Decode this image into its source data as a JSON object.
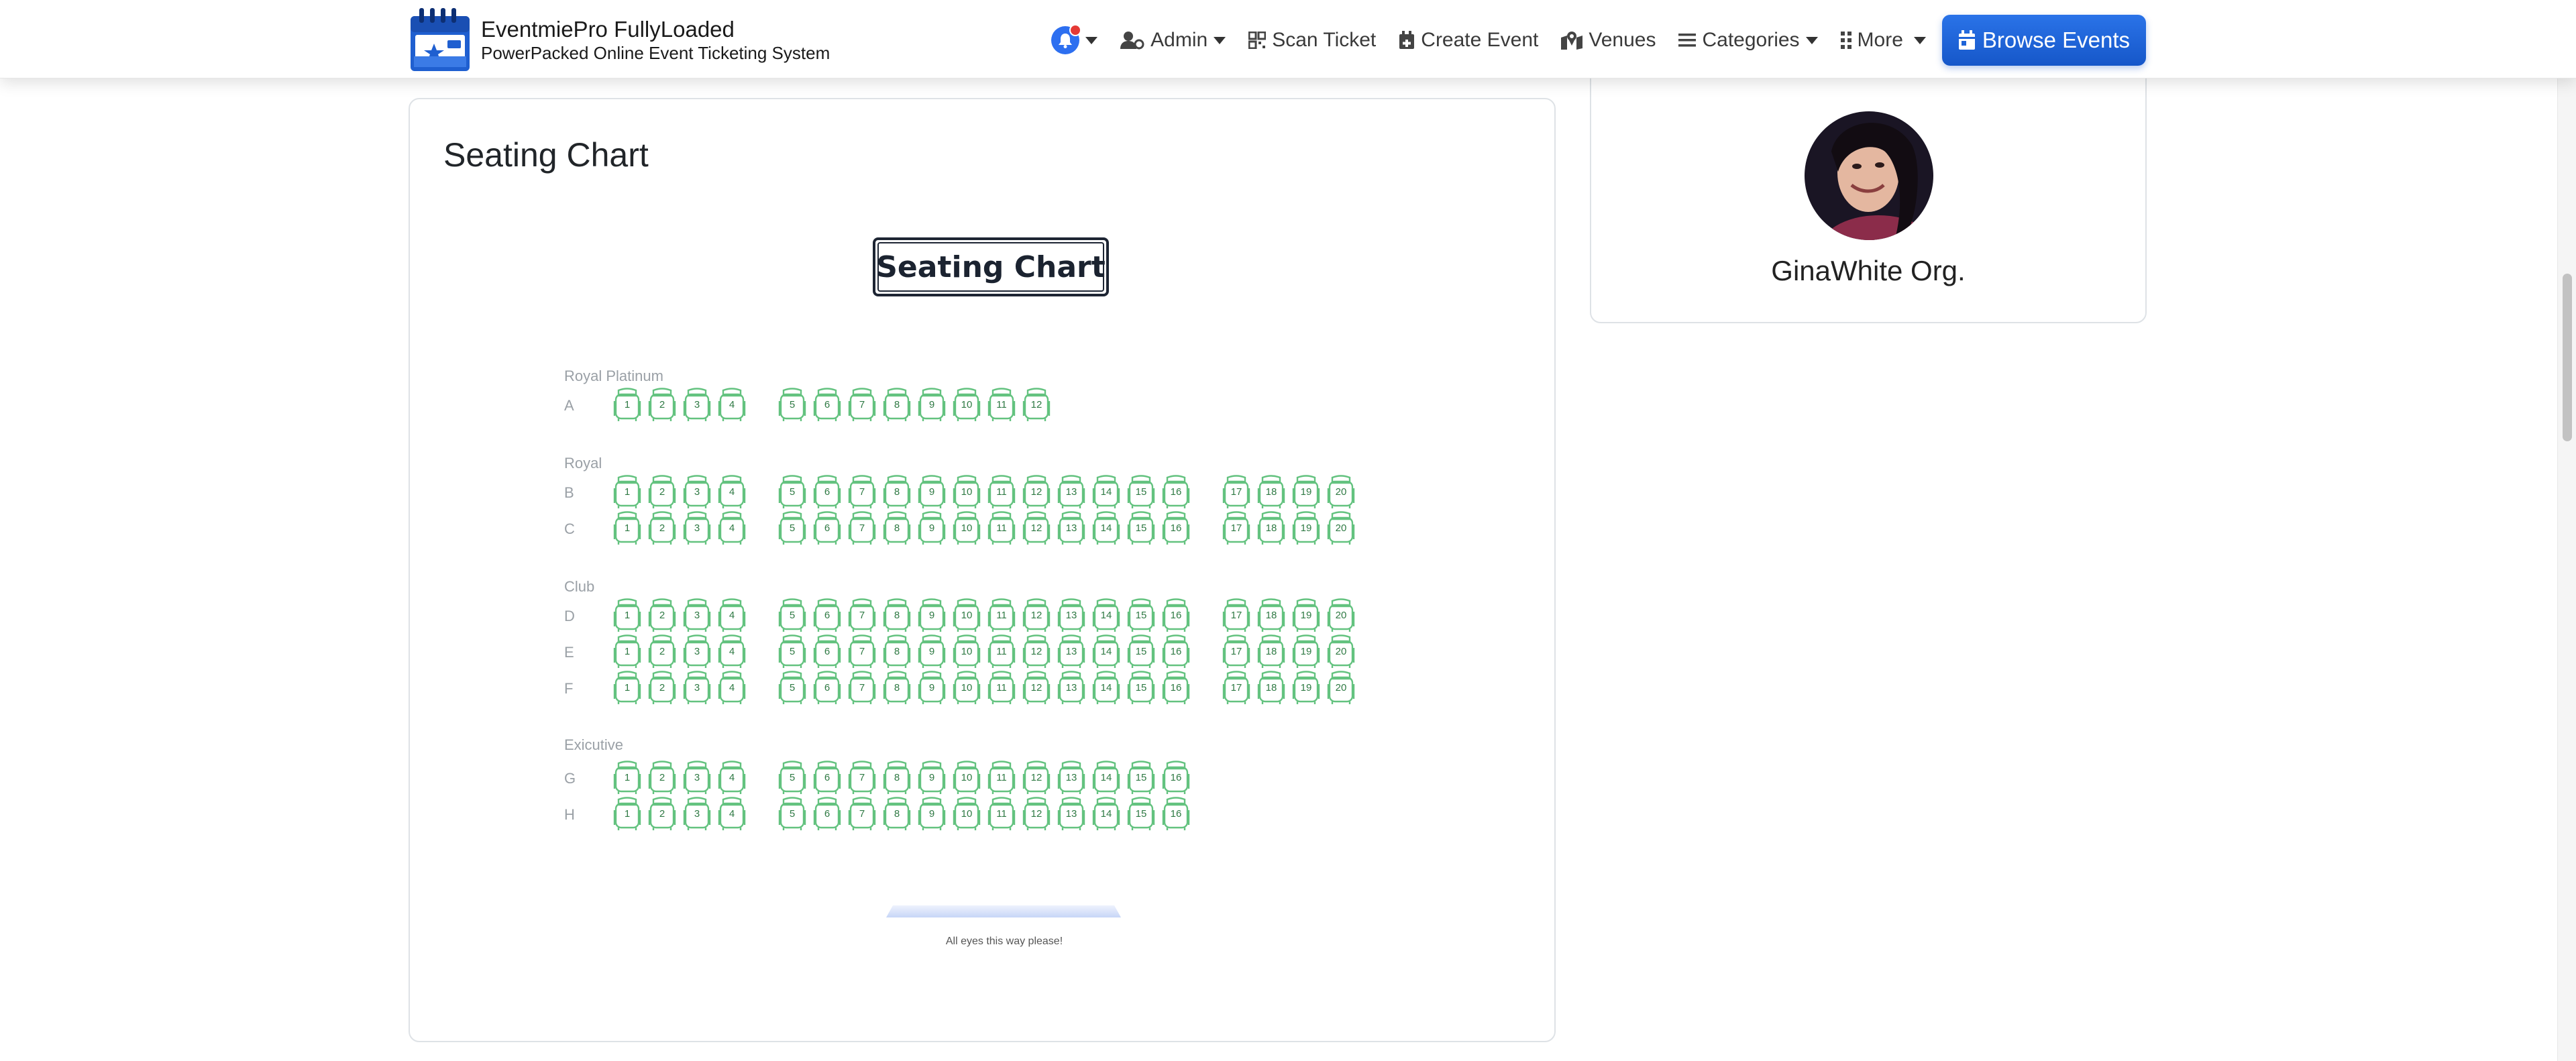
{
  "brand": {
    "title": "EventmiePro FullyLoaded",
    "subtitle": "PowerPacked Online Event Ticketing System"
  },
  "nav": {
    "admin": "Admin",
    "scan_ticket": "Scan Ticket",
    "create_event": "Create Event",
    "venues": "Venues",
    "categories": "Categories",
    "more": "More",
    "browse_events": "Browse Events"
  },
  "colors": {
    "primary": "#1d63d8",
    "seat": "#63c27f",
    "notification": "#e53935"
  },
  "seating": {
    "card_title": "Seating Chart",
    "banner": "Seating Chart",
    "stage_text": "All eyes this way please!",
    "sections": [
      {
        "name": "Royal Platinum",
        "rows": [
          {
            "label": "A",
            "seats": [
              1,
              2,
              3,
              4,
              5,
              6,
              7,
              8,
              9,
              10,
              11,
              12
            ]
          }
        ]
      },
      {
        "name": "Royal",
        "rows": [
          {
            "label": "B",
            "seats": [
              1,
              2,
              3,
              4,
              5,
              6,
              7,
              8,
              9,
              10,
              11,
              12,
              13,
              14,
              15,
              16,
              17,
              18,
              19,
              20
            ]
          },
          {
            "label": "C",
            "seats": [
              1,
              2,
              3,
              4,
              5,
              6,
              7,
              8,
              9,
              10,
              11,
              12,
              13,
              14,
              15,
              16,
              17,
              18,
              19,
              20
            ]
          }
        ]
      },
      {
        "name": "Club",
        "rows": [
          {
            "label": "D",
            "seats": [
              1,
              2,
              3,
              4,
              5,
              6,
              7,
              8,
              9,
              10,
              11,
              12,
              13,
              14,
              15,
              16,
              17,
              18,
              19,
              20
            ]
          },
          {
            "label": "E",
            "seats": [
              1,
              2,
              3,
              4,
              5,
              6,
              7,
              8,
              9,
              10,
              11,
              12,
              13,
              14,
              15,
              16,
              17,
              18,
              19,
              20
            ]
          },
          {
            "label": "F",
            "seats": [
              1,
              2,
              3,
              4,
              5,
              6,
              7,
              8,
              9,
              10,
              11,
              12,
              13,
              14,
              15,
              16,
              17,
              18,
              19,
              20
            ]
          }
        ]
      },
      {
        "name": "Exicutive",
        "rows": [
          {
            "label": "G",
            "seats": [
              1,
              2,
              3,
              4,
              5,
              6,
              7,
              8,
              9,
              10,
              11,
              12,
              13,
              14,
              15,
              16
            ]
          },
          {
            "label": "H",
            "seats": [
              1,
              2,
              3,
              4,
              5,
              6,
              7,
              8,
              9,
              10,
              11,
              12,
              13,
              14,
              15,
              16
            ]
          }
        ]
      }
    ]
  },
  "organizer": {
    "name": "GinaWhite Org."
  }
}
